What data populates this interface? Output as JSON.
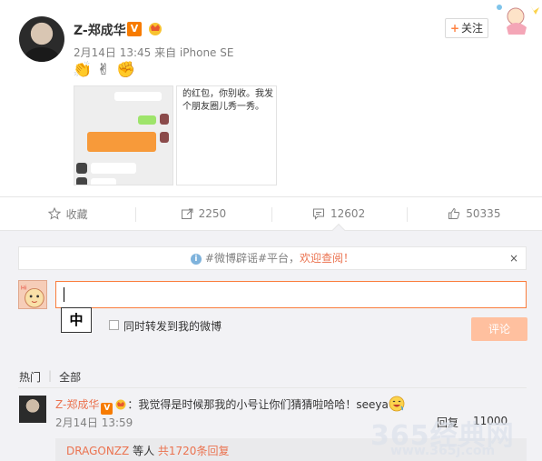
{
  "post": {
    "username": "Z-郑成华",
    "verified_badge": "V",
    "follow_label": "关注",
    "meta": "2月14日 13:45 来自 iPhone SE",
    "emojis": [
      "👏",
      "✌",
      "✊"
    ],
    "image_caption_text": "的红包，你别收。我发个朋友圈儿秀一秀。"
  },
  "actions": {
    "favorite_label": "收藏",
    "repost_count": "2250",
    "comment_count": "12602",
    "like_count": "50335"
  },
  "comment_box": {
    "notice_prefix": "#微博辟谣#平台，",
    "notice_link": "欢迎查阅！",
    "notice_close": "×",
    "ime_char": "中",
    "forward_label": "同时转发到我的微博",
    "submit_label": "评论"
  },
  "filters": {
    "hot": "热门",
    "all": "全部"
  },
  "comments": [
    {
      "user": "Z-郑成华",
      "text": "：我觉得是时候那我的小号让你们猜猜啦哈哈！seeya",
      "time": "2月14日 13:59",
      "reply_label": "回复",
      "like_count": "11000",
      "replies_user": "DRAGONZZ",
      "replies_mid": " 等人 ",
      "replies_link": "共1720条回复"
    }
  ],
  "watermark": {
    "brand": "365经典网",
    "url": "www.365j.com"
  },
  "colors": {
    "accent": "#eb7350",
    "verified": "#f77b00",
    "submit_disabled": "#ffc09f",
    "panel_bg": "#f2f2f5"
  }
}
